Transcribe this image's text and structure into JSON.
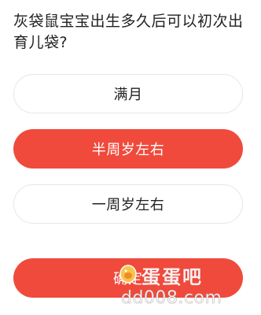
{
  "question": {
    "text": "灰袋鼠宝宝出生多久后可以初次出育儿袋?"
  },
  "options": [
    {
      "label": "满月",
      "selected": false
    },
    {
      "label": "半周岁左右",
      "selected": true
    },
    {
      "label": "一周岁左右",
      "selected": false
    }
  ],
  "confirm": {
    "label": "确定"
  },
  "watermark": {
    "brand": "蛋蛋吧",
    "url": "dd008.com"
  },
  "colors": {
    "accent": "#f04a3c",
    "text": "#222222",
    "option_border": "#e6e6e6"
  }
}
